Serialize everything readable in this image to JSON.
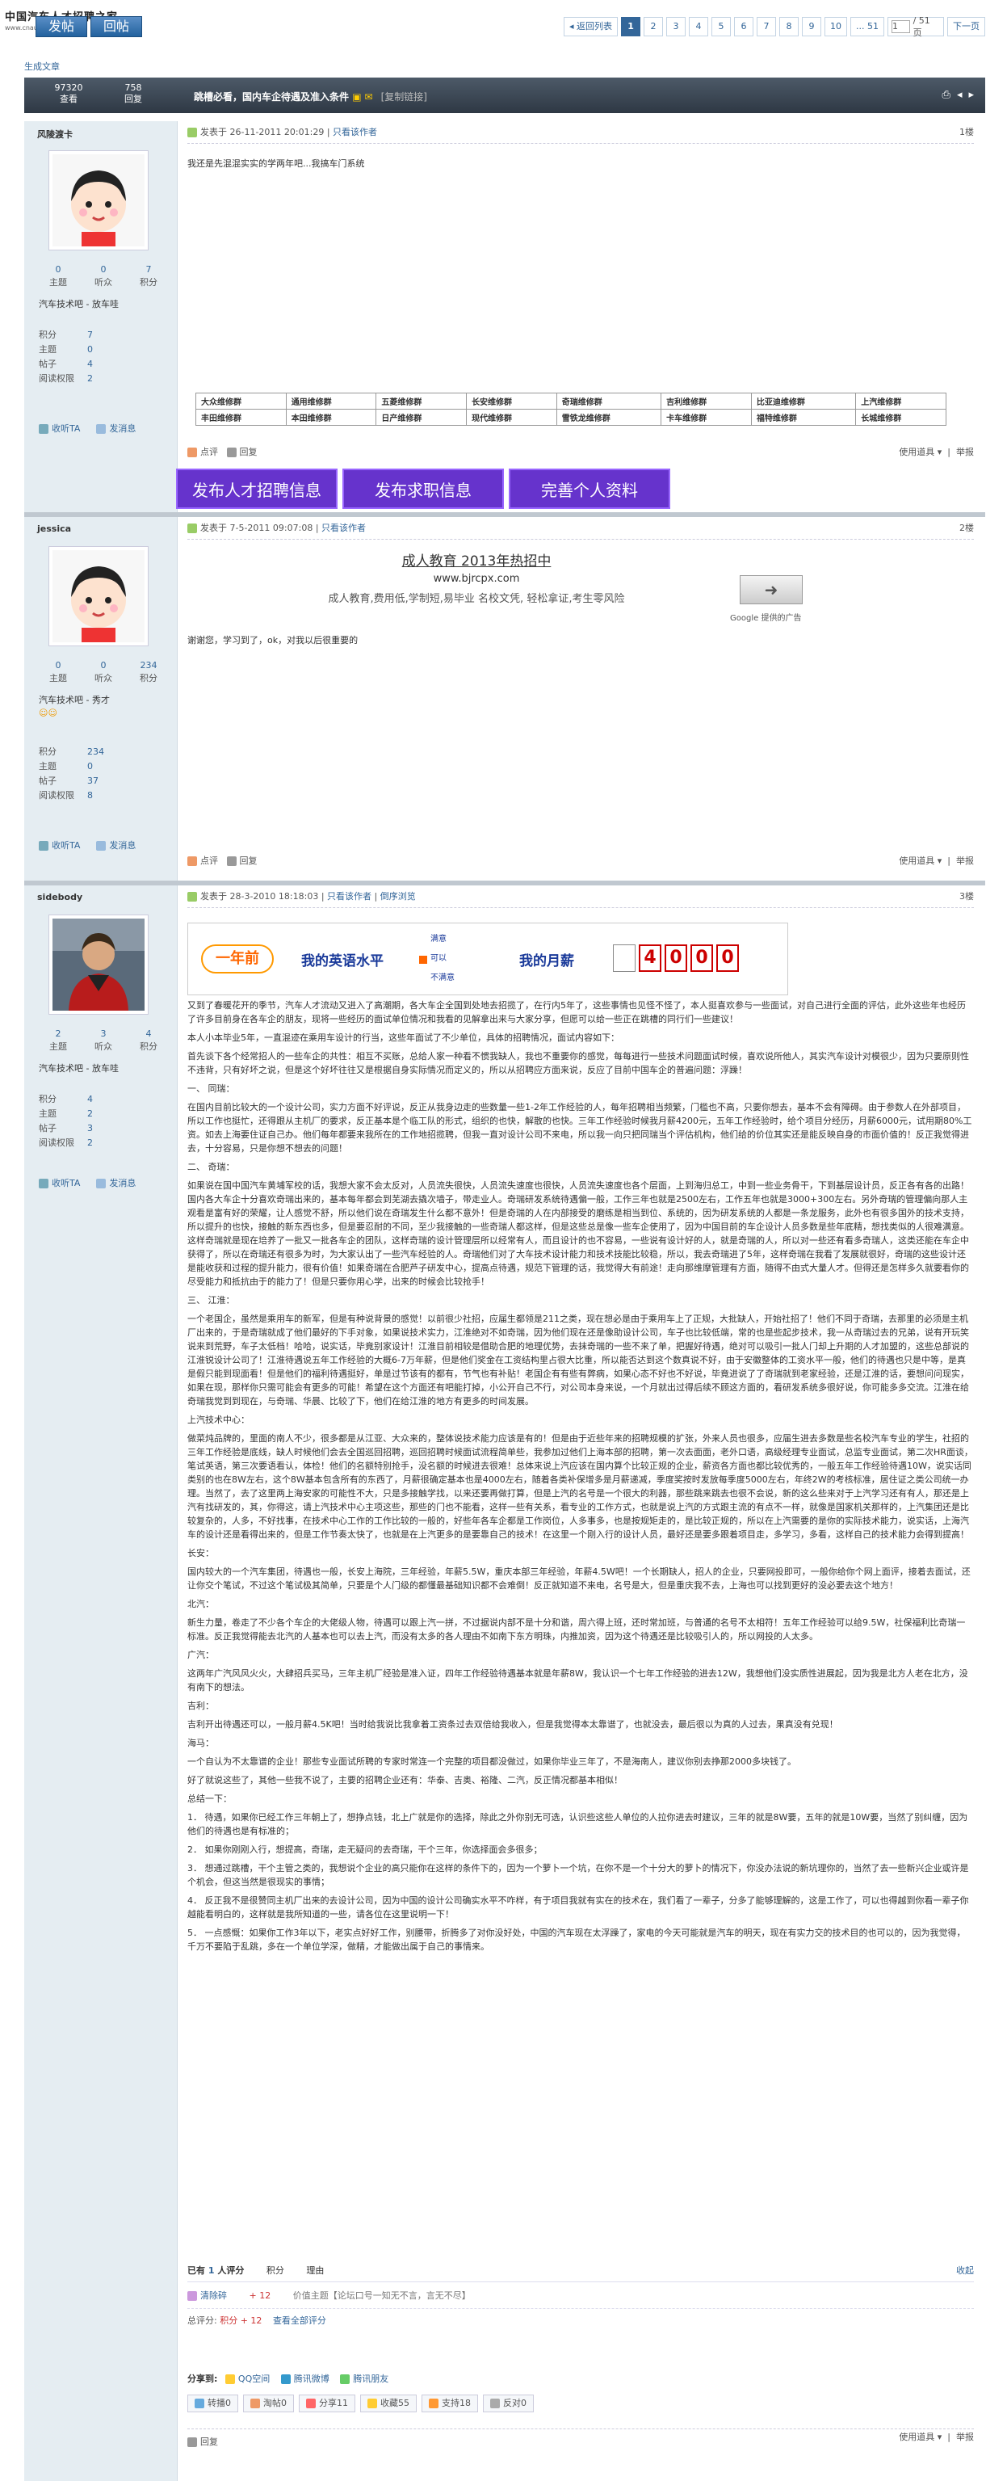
{
  "site": {
    "logo": "中国汽车人才招聘之家",
    "logo_sub": "www.cnautojob.com"
  },
  "toolbar": {
    "post_label": "发帖",
    "reply_label": "回帖"
  },
  "pagination": {
    "back": "返回列表",
    "pages": [
      "1",
      "2",
      "3",
      "4",
      "5",
      "6",
      "7",
      "8",
      "9",
      "10",
      "... 51"
    ],
    "current": "1",
    "jump_value": "1",
    "total": "/ 51 页",
    "next": "下一页"
  },
  "breadcrumb": "生成文章",
  "thread": {
    "views": "97320",
    "views_label": "查看",
    "replies": "758",
    "replies_label": "回复",
    "title": "跳槽必看，国内车企待遇及准入条件",
    "copy_link": "[复制链接]"
  },
  "posts": [
    {
      "user": "风陵渡卡",
      "stats": [
        {
          "v": "0",
          "l": "主题"
        },
        {
          "v": "0",
          "l": "听众"
        },
        {
          "v": "7",
          "l": "积分"
        }
      ],
      "group": "汽车技术吧 - 放车哇",
      "stars": "",
      "info": [
        {
          "k": "积分",
          "v": "7"
        },
        {
          "k": "主题",
          "v": "0"
        },
        {
          "k": "帖子",
          "v": "4"
        },
        {
          "k": "阅读权限",
          "v": "2"
        }
      ],
      "posted": "发表于 26-11-2011 20:01:29",
      "only": "只看该作者",
      "floor": "1楼",
      "text": "我还是先混混实实的学两年吧...我搞车门系统",
      "grid": [
        [
          "大众维修群",
          "通用维修群",
          "五菱维修群",
          "长安维修群",
          "奇瑞维修群",
          "吉利维修群",
          "比亚迪维修群",
          "上汽维修群"
        ],
        [
          "丰田维修群",
          "本田维修群",
          "日产维修群",
          "现代维修群",
          "雪铁龙维修群",
          "卡车维修群",
          "福特维修群",
          "长城维修群"
        ]
      ],
      "rate_label": "点评",
      "reply_label": "回复",
      "tools": "使用道具",
      "report": "举报",
      "purple": [
        "发布人才招聘信息",
        "发布求职信息",
        "完善个人资料"
      ]
    },
    {
      "user": "jessica",
      "stats": [
        {
          "v": "0",
          "l": "主题"
        },
        {
          "v": "0",
          "l": "听众"
        },
        {
          "v": "234",
          "l": "积分"
        }
      ],
      "group": "汽车技术吧 - 秀才",
      "stars": "☺☺",
      "info": [
        {
          "k": "积分",
          "v": "234"
        },
        {
          "k": "主题",
          "v": "0"
        },
        {
          "k": "帖子",
          "v": "37"
        },
        {
          "k": "阅读权限",
          "v": "8"
        }
      ],
      "posted": "发表于 7-5-2011 09:07:08",
      "only": "只看该作者",
      "floor": "2楼",
      "ad_title": "成人教育 2013年热招中",
      "ad_url": "www.bjrcpx.com",
      "ad_desc": "成人教育,费用低,学制短,易毕业 名校文凭, 轻松拿证,考生零风险",
      "ad_brand": "Google 提供的广告",
      "text": "谢谢您，学习到了，ok，对我以后很重要的",
      "rate_label": "点评",
      "reply_label": "回复",
      "tools": "使用道具",
      "report": "举报"
    },
    {
      "user": "sidebody",
      "stats": [
        {
          "v": "2",
          "l": "主题"
        },
        {
          "v": "3",
          "l": "听众"
        },
        {
          "v": "4",
          "l": "积分"
        }
      ],
      "group": "汽车技术吧 - 放车哇",
      "stars": "",
      "info": [
        {
          "k": "积分",
          "v": "4"
        },
        {
          "k": "主题",
          "v": "2"
        },
        {
          "k": "帖子",
          "v": "3"
        },
        {
          "k": "阅读权限",
          "v": "2"
        }
      ],
      "posted": "发表于 28-3-2010 18:18:03",
      "only": "只看该作者",
      "sort": "倒序浏览",
      "floor": "3楼",
      "banner": {
        "left": "一年前",
        "mid": "我的英语水平",
        "opts": [
          "满意",
          "可以",
          "不满意"
        ],
        "right": "我的月薪",
        "digits": [
          "4",
          "0",
          "0",
          "0"
        ]
      },
      "paras": [
        "又到了春暖花开的季节，汽车人才流动又进入了高潮期，各大车企全国到处地去招揽了，在行内5年了，这些事情也见怪不怪了，本人挺喜欢参与一些面试，对自己进行全面的评估，此外这些年也经历了许多目前身在各车企的朋友，现将一些经历的面试单位情况和我看的见解拿出来与大家分享，但愿可以给一些正在跳槽的同行们一些建议！",
        "本人小本毕业5年，一直混迹在乘用车设计的行当，这些年面试了不少单位，具体的招聘情况，面试内容如下：",
        "首先谈下各个经常招人的一些车企的共性：相互不买账，总给人家一种看不惯我缺人，我也不重要你的感觉，每每进行一些技术问题面试时候，喜欢说所他人，其实汽车设计对模很少，因为只要原则性不违背，只有好坏之说，但是这个好坏往往又是根据自身实际情况而定义的，所以从招聘应方面来说，反应了目前中国车企的普遍问题：浮躁！",
        "一、   同瑞：",
        "在国内目前比较大的一个设计公司，实力方面不好评说，反正从我身边走的些数量一些1-2年工作经验的人，每年招聘相当频繁，门槛也不高，只要你想去，基本不会有障碍。由于参数人在外部项目，所以工作也挺忙，还得跟从主机厂的要求，反正基本是个临工队的形式，组织的也快，解散的也快。三年工作经验时候我月薪4200元，五年工作经验时，给个项目分经历，月薪6000元，试用期80%工资。如去上海要住证自己办。他们每年都要来我所在的工作地招揽聘，但我一直对设计公司不来电，所以我一向只把同瑞当个评估机构，他们给的价位其实还是能反映自身的市面价值的！反正我觉得进去，十分容易，只是你想不想去的问题！",
        "二、   奇瑞：",
        "如果说在国中国汽车黄埔军校的话，我想大家不会太反对，人员流失很快，人员流失速度也很快，人员流失速度也各个层面，上到海归总工，中到一些业务骨干，下到基层设计员，反正各有各的出路！国内各大车企十分喜欢奇瑞出来的，基本每年都会到芜湖去撬次墙子，带走业人。奇瑞研发系统待遇偏一般，工作三年也就是2500左右，工作五年也就是3000+300左右。另外奇瑞的管理偏向那人主观看是富有好的荣耀，让人感觉不舒，所以他们说在奇瑞发生什么都不意外！但是奇瑞的人在内部接受的磨练是相当到位、系统的，因为研发系统的人都是一条龙服务，此外也有很多国外的技术支持，所以提升的也快，接触的新东西也多，但是要忍耐的不同，至少我接触的一些奇瑞人都这样，但是这些总是像一些车企使用了，因为中国目前的车企设计人员多数是些年底精，想找类似的人很难满意。这样奇瑞就是现在培养了一批又一批各车企的团队，这样奇瑞的设计管理层所以经常有人，而且设计的也不容易，一些说有设计好的人，就是奇瑞的人，所以对一些还有看多奇瑞人，这类还能在车企中获得了，所以在奇瑞还有很多为时，为大家认出了一些汽车经验的人。奇瑞他们对了大车技术设计能力和技术技能比较稳，所以，我去奇瑞进了5年，这样奇瑞在我看了发展就很好，奇瑞的这些设计还是能收获和过程的提升能力，很有价值！如果奇瑞在合肥芦子研发中心，提高点待遇，规范下管理的话，我觉得大有前途！走向那维摩管理有方面，随得不由式大量人才。但得还是怎样多久就要看你的尽受能力和抵抗由于的能力了！但是只要你用心学，出来的时候会比较抢手！",
        "三、      江淮：",
        "一个老国企，虽然是乘用车的新军，但是有种说背景的感觉！以前很少社招，应届生都领是211之类，现在想必是由于乘用车上了正规，大批缺人，开始社招了！他们不同于奇瑞，去那里的必须是主机厂出来的，于是奇瑞就成了他们最好的下手对象，如果说技术实力，江淮绝对不如奇瑞，因为他们现在还是像助设计公司，车子也比较低端，常的也是些起步技术，我一从奇瑞过去的兄弟，说有开玩笑说来到荒野，车子太低档！哈哈，说实话，毕竟别家设计！江淮目前相较是借助合肥的地理优势，去抹奇瑞的一些不来了单，把握好待遇，绝对可以吸引一批人门却上升期的人才加盟的，这些总部说的江淮锐设计公司了！江淮待遇说五年工作经验的大概6-7万年薪，但是他们奖金在工资结构里占很大比重，所以能否达到这个数真说不好，由于安徽整体的工资水平一般，他们的待遇也只是中等，是真是假只能到现面看！但是他们的福利待遇挺好，单是过节该有的都有，节气也有补贴！老国企有有些有弊病，如果心态不好也不好说，毕竟进说了了奇瑞就到老家经验，还是江淮的话，要想问问现实，如果在现，那样你只需可能会有更多的可能！希望在这个方面还有吧能打掉，小公开自己不行，对公司本身来说，一个月就出过得后续不顾这方面的，看研发系统多很好说，你可能多多交流。江淮在给奇瑞我觉到到现在，与奇瑞、华晨、比较了下，他们在给江淮的地方有更多的时间发展。",
        "上汽技术中心：",
        "做菜炖品牌的，里面的南人不少，很多都是从江亚、大众来的，整体说技术能力应该是有的！但是由于近些年来的招聘规模的扩张，外来人员也很多，应届生进去多数是些名校汽车专业的学生，社招的三年工作经验是底线，缺人时候他们会去全国巡回招聘，巡回招聘时候面试流程简单些，我参加过他们上海本部的招聘，第一次去面面，老外口语，高级经理专业面试，总监专业面试，第二次HR面谈，笔试英语，第三次要语看认，体检！他们的名额特别抢手，没名额的时候进去很难！总体来说上汽应该在国内算个比较正规的企业，薪资各方面也都比较优秀的，一般五年工作经验待遇10W，说实话同类别的也在8W左右，这个8W基本包含所有的东西了，月薪很确定基本也是4000左右，随着各类补保增多是月薪递减，季度奖按时发放每季度5000左右，年终2W的考核标准，居住证之类公司统一办理。当然了，去了这里两上海安家的可能性不大，只是多接触学找，以来还要再做打算，但是上汽的名号是一个很大的利器，那些跳来跳去也很不会说，新的这么些来对于上汽学习还有有人，那还是上汽有找研发的，其，你得这，请上汽技术中心主项这些，那些的门也不能看，这样一些有关系，看专业的工作方式，也就是说上汽的方式跟主流的有点不一样，就像是国家机关那样的，上汽集团还是比较复杂的，人多，不好找事，在技术中心工作的工作比较的一般的，好些年各车企都是工作岗位，人多事多，也是按规矩走的，是比较正规的，所以在上汽需要的是你的实际技术能力，说实话，上海汽车的设计还是看得出来的，但是工作节奏太快了，也就是在上汽更多的是要靠自己的技术！在这里一个刚入行的设计人员，最好还是要多跟着项目走，多学习，多看，这样自己的技术能力会得到提高！",
        "长安：",
        "国内较大的一个汽车集团，待遇也一般，长安上海院，三年经验，年薪5.5W，重庆本部三年经验，年薪4.5W吧！一个长期缺人，招人的企业，只要网投即可，一般你给你个网上面评，接着去面试，还让你交个笔试，不过这个笔试极其简单，只要是个人门级的都懂最基础知识都不会难倒！反正就知道不来电，名号是大，但是重庆我不去，上海也可以找到更好的没必要去这个地方！",
        "北汽：",
        "新生力量，卷走了不少各个车企的大佬级人物，待遇可以跟上汽一拼，不过据说内部不是十分和谐，周六得上班，还时常加班，与普通的名号不太相符！五年工作经验可以给9.5W，社保福利比奇瑞一标准。反正我觉得能去北汽的人基本也可以去上汽，而没有太多的各人理由不如南下东方明珠，内推加资，因为这个待遇还是比较吸引人的，所以网投的人太多。",
        "广汽：",
        "这两年广汽风风火火，大肆招兵买马，三年主机厂经验是准入证，四年工作经验待遇基本就是年薪8W，我认识一个七年工作经验的进去12W，我想他们没实质性进展起，因为我是北方人老在北方，没有南下的想法。",
        "吉利：",
        "吉利开出待遇还可以，一般月薪4.5K吧！当时给我说比我拿着工资条过去双倍给我收入，但是我觉得本太靠谱了，也就没去，最后很以为真的人过去，果真没有兑现！",
        "海马：",
        "一个自认为不太靠谱的企业！那些专业面试所聘的专家时常连一个完整的项目都没做过，如果你毕业三年了，不是海南人，建议你别去挣那2000多块钱了。",
        "好了就说这些了，其他一些我不说了，主要的招聘企业还有：华泰、吉奥、裕隆、二汽，反正情况都基本相似！",
        "总结一下：",
        "1．    待遇，如果你已经工作三年朝上了，想挣点钱，北上广就是你的选择，除此之外你别无可选，认识些这些人单位的人拉你进去时建议，三年的就是8W要，五年的就是10W要，当然了别纠缠，因为他们的待遇也是有标准的；",
        "2．    如果你刚刚入行，想提高，奇瑞，走无疑问的去奇瑞，干个三年，你选择面会多很多；",
        "3．    想通过跳槽，干个主管之类的，我想说个企业的高只能你在这样的条件下的，因为一个萝卜一个坑，在你不是一个十分大的萝卜的情况下，你没办法说的新坑理你的，当然了去一些新兴企业或许是个机会，但这当然是很现实的事情；",
        "4．    反正我不是很赞同主机厂出来的去设计公司，因为中国的设计公司确实水平不咋样，有于项目我就有实在的技术在，我们看了一辈子，分多了能够理解的，这是工作了，可以也得越到你看一辈子你越能看明白的，这样就是我所知道的一些，请各位在这里说明一下！",
        "5．    一点感慨：如果你工作3年以下，老实点好好工作，别腰带，折腾多了对你没好处，中国的汽车现在太浮躁了，家电的今天可能就是汽车的明天，现在有实力交的技术目的也可以的，因为我觉得，千万不要陷于乱跳，多在一个单位学深，做精，才能做出属于自己的事情来。"
      ],
      "rating": {
        "count_prefix": "已有",
        "count": "1",
        "count_suffix": "人评分",
        "col_score": "积分",
        "col_reason": "理由",
        "collapse": "收起",
        "rater": "清除碎",
        "score": "+ 12",
        "reason": "价值主题【论坛口号一知无不言，言无不尽】",
        "total_label": "总评分:",
        "total": "积分 + 12",
        "view_all": "查看全部评分"
      },
      "share": {
        "label": "分享到:",
        "items": [
          "QQ空间",
          "腾讯微博",
          "腾讯朋友"
        ]
      },
      "actions": [
        "转播0",
        "淘帖0",
        "分享11",
        "收藏55",
        "支持18",
        "反对0"
      ],
      "rate_label": "点评",
      "reply_label": "回复",
      "tools": "使用道具",
      "report": "举报"
    }
  ]
}
